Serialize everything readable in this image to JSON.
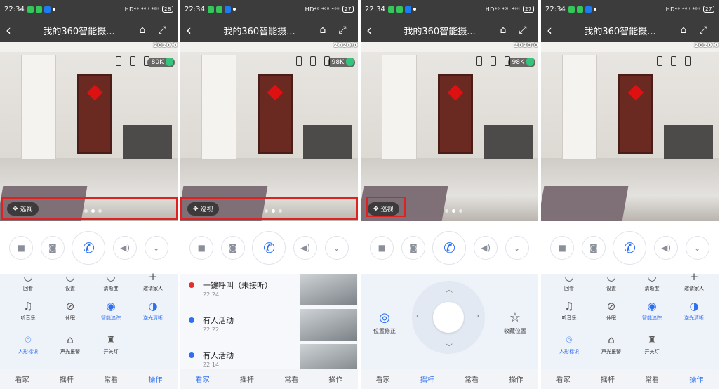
{
  "status": {
    "time": "22:34",
    "right": "HD⁴⁶ ⁴⁶ᴵᴵ ⁴⁶ᴵᴵ",
    "battery_p1": "28",
    "battery_other": "27"
  },
  "title": "我的360智能摄...",
  "video": {
    "date": "2020/0",
    "speeds": [
      "80K",
      "98K",
      "98K"
    ],
    "patrol": "巡视"
  },
  "controls": {
    "icons": [
      "video-icon",
      "camera-icon",
      "phone-icon",
      "volume-icon",
      "chevron-down-icon"
    ]
  },
  "ops": {
    "row1": [
      "回看",
      "设置",
      "清晰度",
      "邀请家人"
    ],
    "row2": [
      "听音乐",
      "休眠",
      "智能追踪",
      "逆光清晰"
    ],
    "row3": [
      "人形标识",
      "声光报警",
      "开关灯"
    ]
  },
  "events": [
    {
      "title": "一键呼叫（未接听）",
      "time": "22:24"
    },
    {
      "title": "有人活动",
      "time": "22:22"
    },
    {
      "title": "有人活动",
      "time": "22:14"
    }
  ],
  "joystick": {
    "left": "位置修正",
    "right": "收藏位置"
  },
  "tabs": [
    "看家",
    "摇杆",
    "常看",
    "操作"
  ],
  "colors": {
    "accent": "#2e6ff2",
    "bar": "#3c3c3c",
    "highlight": "#dd2222"
  }
}
